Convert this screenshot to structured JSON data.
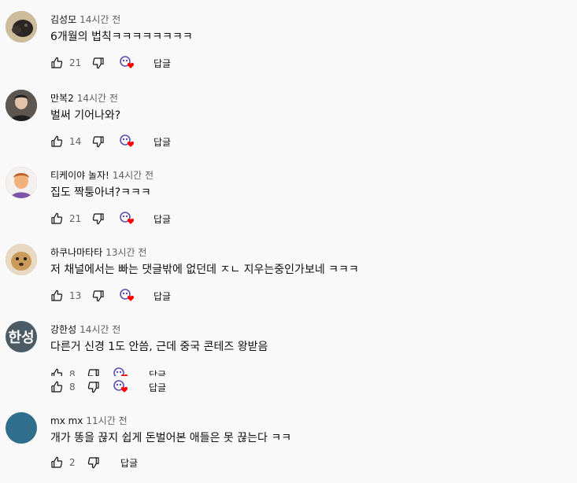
{
  "labels": {
    "reply": "답글"
  },
  "comments": [
    {
      "author": "김성모",
      "time": "14시간 전",
      "text": "6개월의 법칙ㅋㅋㅋㅋㅋㅋㅋㅋ",
      "likes": "21",
      "avatar": {
        "type": "photo",
        "color": "#b8a58a"
      }
    },
    {
      "author": "만복2",
      "time": "14시간 전",
      "text": "벌써 기어나와?",
      "likes": "14",
      "avatar": {
        "type": "photo",
        "color": "#3a3a3a"
      }
    },
    {
      "author": "티케이야 놀자!",
      "time": "14시간 전",
      "text": "집도 짝퉁아녀?ㅋㅋㅋ",
      "likes": "21",
      "avatar": {
        "type": "photo",
        "color": "#7e55a8"
      }
    },
    {
      "author": "하쿠나마타타",
      "time": "13시간 전",
      "text": "저 채널에서는 빠는 댓글밖에 없던데 ㅈㄴ 지우는중인가보네 ㅋㅋㅋ",
      "likes": "13",
      "avatar": {
        "type": "photo",
        "color": "#c9a36a"
      }
    },
    {
      "author": "강한성",
      "time": "14시간 전",
      "text": "다른거 신경 1도 안씀, 근데 중국 콘테즈 왕받음",
      "likes": "8",
      "avatar": {
        "type": "initials",
        "initials": "한성",
        "color": "#4d5b66"
      }
    },
    {
      "author": "mx mx",
      "time": "11시간 전",
      "text": "개가 똥을 끊지 쉽게 돈벌어본 애들은 못 끊는다 ㅋㅋ",
      "likes": "2",
      "avatar": {
        "type": "plain",
        "color": "#2f6e8c"
      }
    }
  ],
  "icons": {
    "like": "thumbs-up-icon",
    "dislike": "thumbs-down-icon",
    "creator_heart": "creator-heart-icon"
  },
  "colors": {
    "heart": "#ff0000",
    "heart_avatar": "#5a4fb0"
  }
}
